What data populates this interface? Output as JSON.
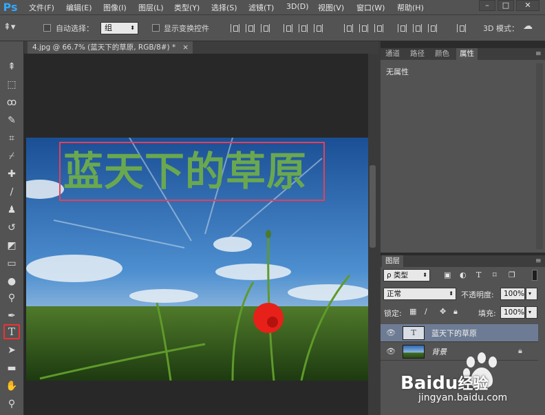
{
  "app": {
    "logo": "Ps"
  },
  "menu": [
    "文件(F)",
    "编辑(E)",
    "图像(I)",
    "图层(L)",
    "类型(Y)",
    "选择(S)",
    "滤镜(T)",
    "3D(D)",
    "视图(V)",
    "窗口(W)",
    "帮助(H)"
  ],
  "window_controls": {
    "minimize": "–",
    "restore": "□",
    "close": "✕"
  },
  "options": {
    "auto_select_label": "自动选择：",
    "auto_select_value": "组",
    "show_transform_label": "显示变换控件",
    "mode_3d_label": "3D 模式："
  },
  "document": {
    "tab_title": "4.jpg @ 66.7% (蓝天下的草原, RGB/8#) *",
    "tab_close": "×"
  },
  "canvas_text": "蓝天下的草原",
  "properties_panel": {
    "tabs": [
      "通道",
      "路径",
      "颜色",
      "属性"
    ],
    "active_tab": "属性",
    "empty_text": "无属性"
  },
  "layers_panel": {
    "tab": "图层",
    "filter_label": "ρ 类型",
    "blend_mode": "正常",
    "opacity_label": "不透明度:",
    "opacity_value": "100%",
    "lock_label": "锁定:",
    "fill_label": "填充:",
    "fill_value": "100%",
    "layers": [
      {
        "name": "蓝天下的草原",
        "type_glyph": "T",
        "selected": true
      },
      {
        "name": "背景",
        "type_glyph": "",
        "selected": false
      }
    ]
  },
  "watermark": {
    "brand_a": "Bai",
    "brand_b": "du",
    "brand_c": "经验",
    "url": "jingyan.baidu.com"
  },
  "colors": {
    "accent": "#31a8ff",
    "highlight_red": "#e33333",
    "text_green": "#6aa84f",
    "selected_layer": "#6d7c94"
  }
}
